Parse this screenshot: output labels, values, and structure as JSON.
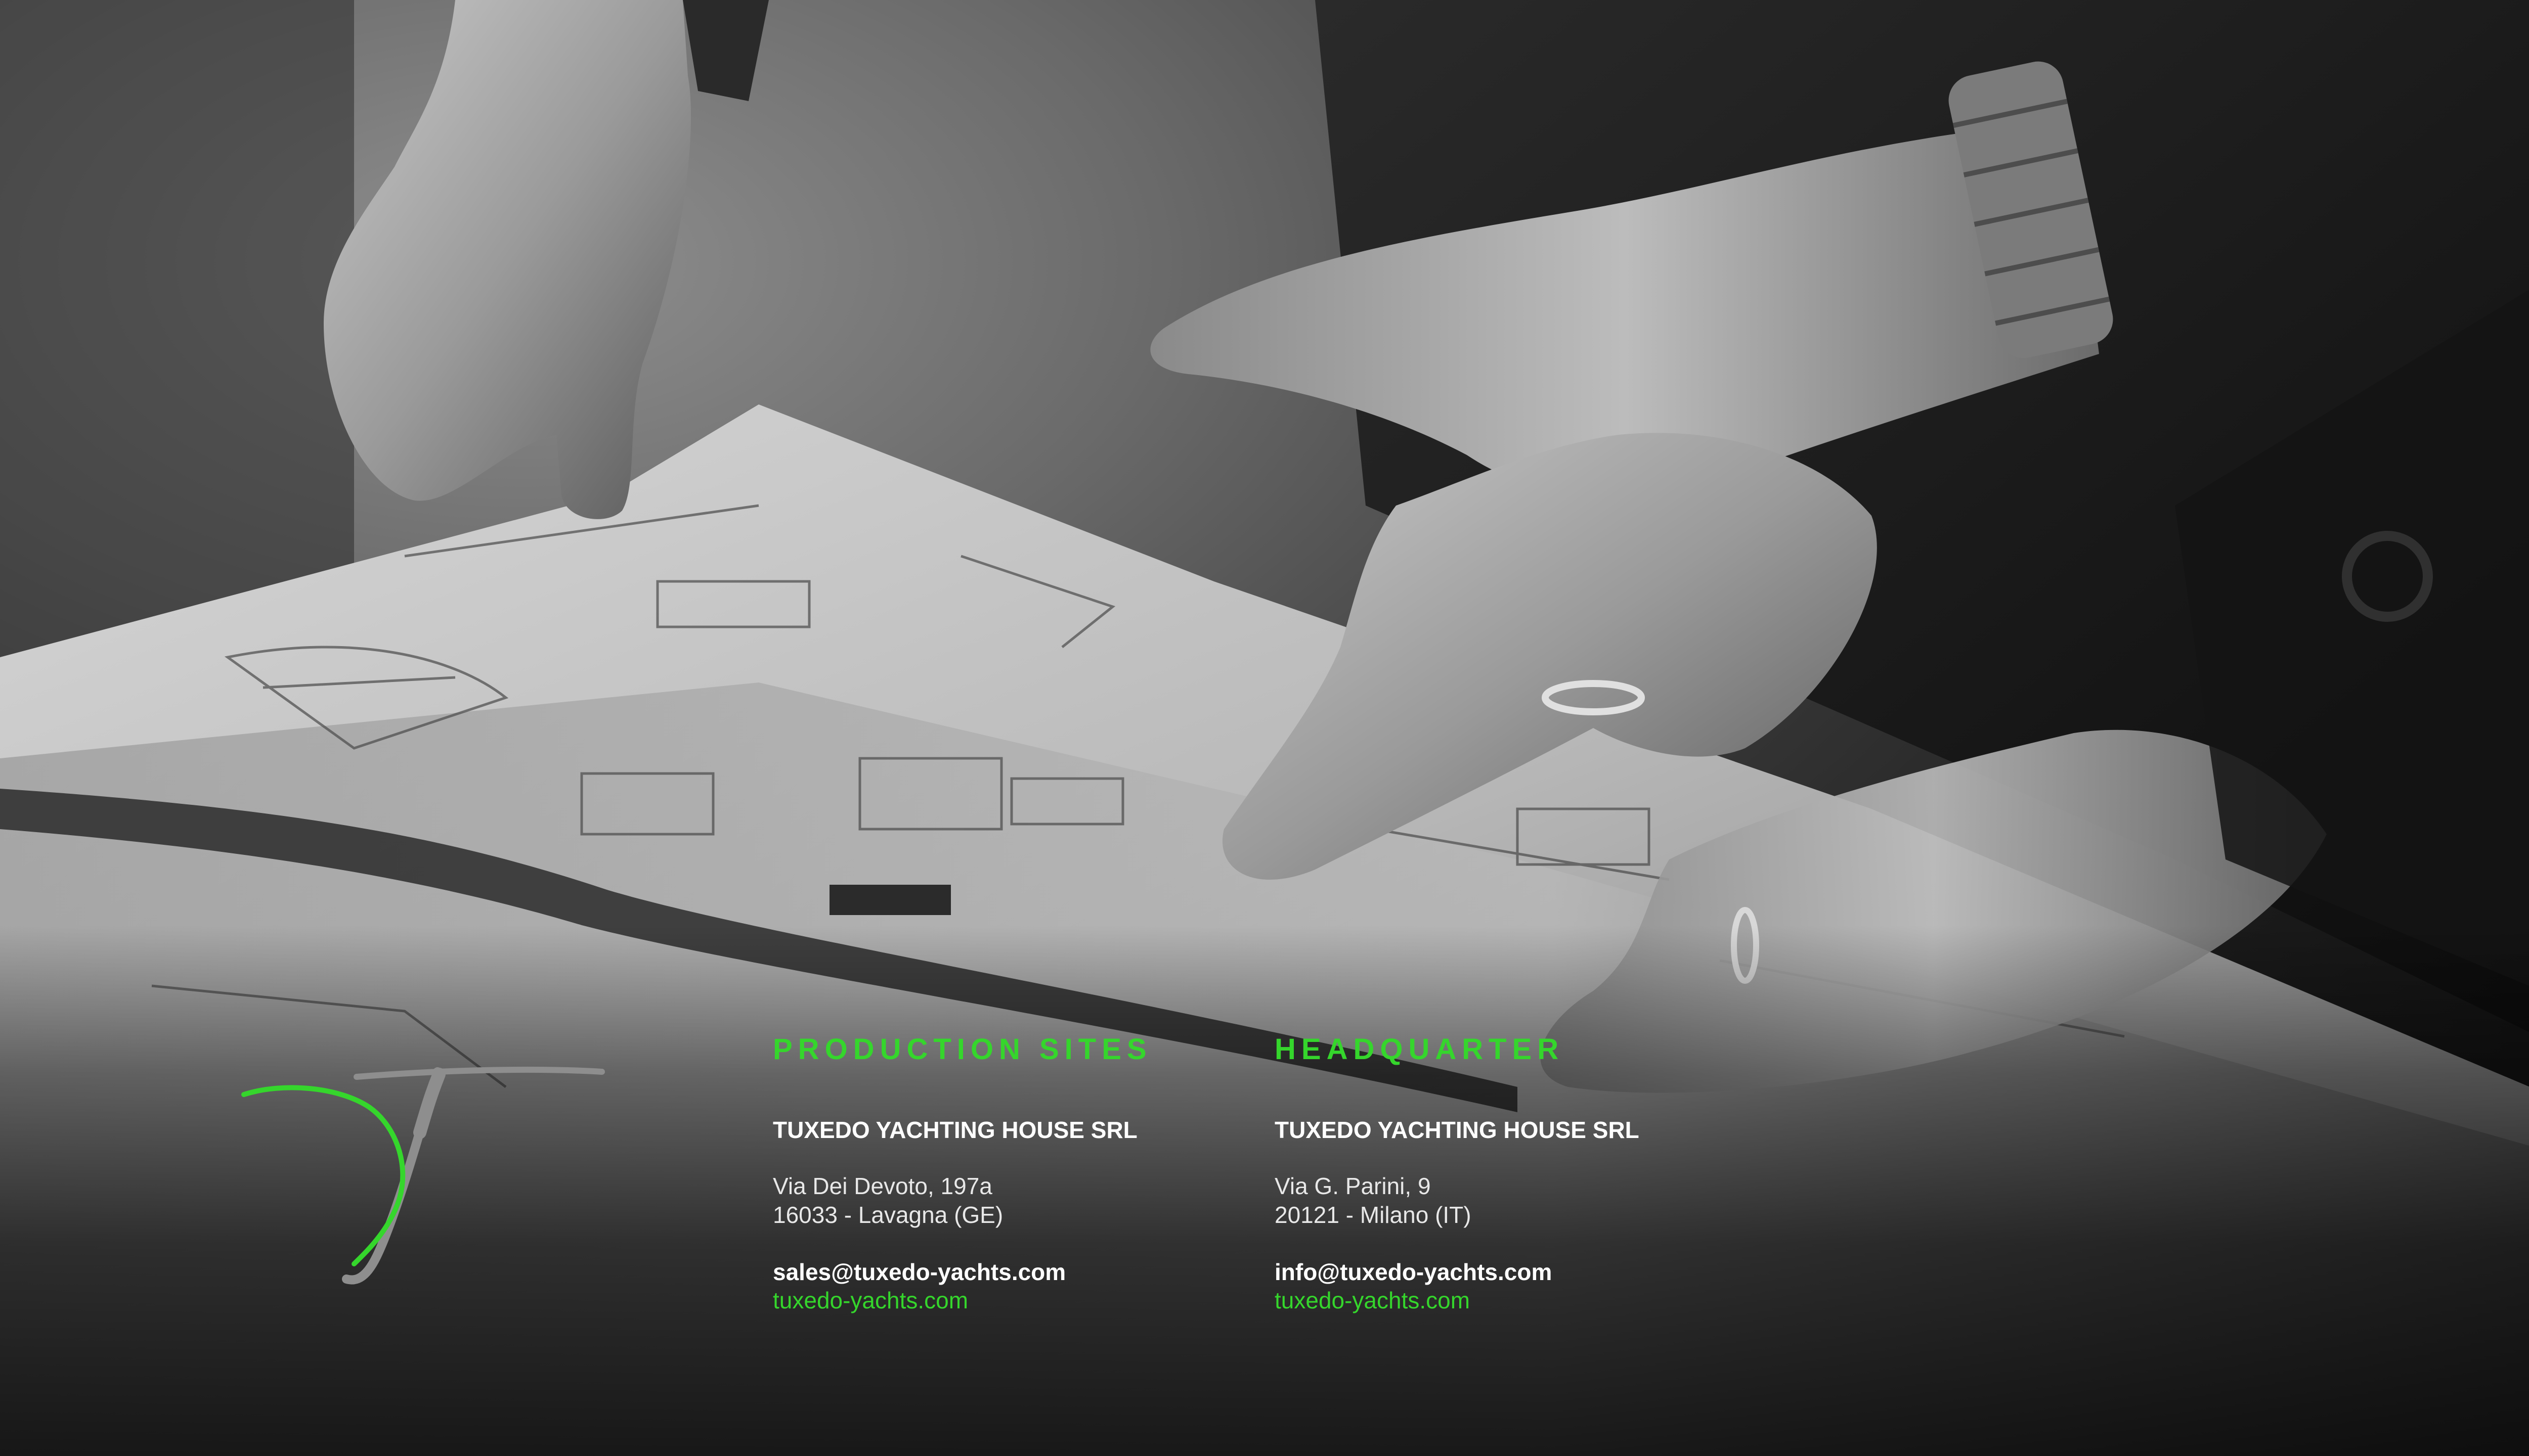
{
  "background": {
    "description_icon": "blueprint-hands-photo",
    "tone": "grayscale"
  },
  "brand": {
    "accent_color": "#35d62c",
    "logo_icon": "tuxedo-t-logo-icon"
  },
  "production": {
    "heading": "PRODUCTION SITES",
    "company": "TUXEDO YACHTING HOUSE SRL",
    "address_line1": "Via Dei Devoto, 197a",
    "address_line2": "16033 - Lavagna (GE)",
    "email": "sales@tuxedo-yachts.com",
    "website": "tuxedo-yachts.com"
  },
  "headquarter": {
    "heading": "HEADQUARTER",
    "company": "TUXEDO YACHTING HOUSE SRL",
    "address_line1": "Via G. Parini, 9",
    "address_line2": "20121 - Milano (IT)",
    "email": "info@tuxedo-yachts.com",
    "website": "tuxedo-yachts.com"
  }
}
